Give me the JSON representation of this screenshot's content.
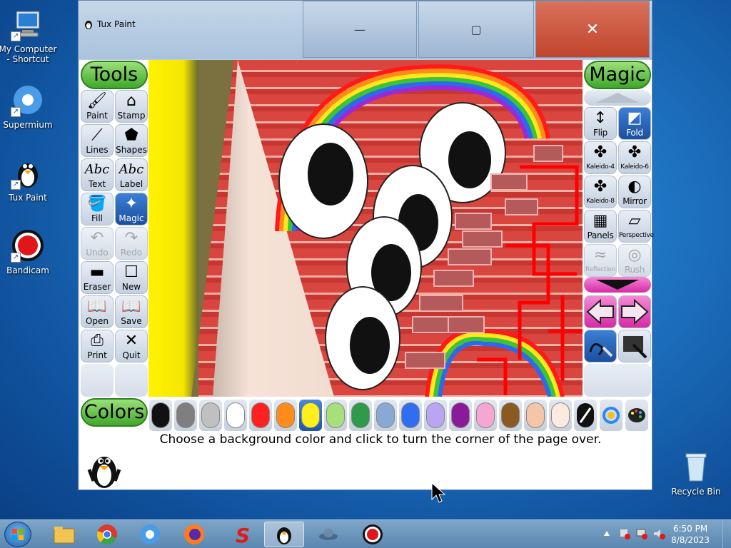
{
  "desktop": {
    "icons": [
      {
        "label": "My Computer - Shortcut"
      },
      {
        "label": "Supermium"
      },
      {
        "label": "Tux Paint"
      },
      {
        "label": "Bandicam"
      },
      {
        "label": "Recycle Bin"
      }
    ]
  },
  "window": {
    "title": "Tux Paint",
    "minimize_glyph": "—",
    "maximize_glyph": "▢",
    "close_glyph": "✕"
  },
  "tools": {
    "title": "Tools",
    "items": [
      {
        "label": "Paint",
        "icon": "paintbrush-icon",
        "glyph": "🖌"
      },
      {
        "label": "Stamp",
        "icon": "stamp-icon",
        "glyph": "⌂"
      },
      {
        "label": "Lines",
        "icon": "lines-icon",
        "glyph": "⟋"
      },
      {
        "label": "Shapes",
        "icon": "shapes-icon",
        "glyph": "⬟"
      },
      {
        "label": "Text",
        "icon": "text-icon",
        "glyph": "Abc"
      },
      {
        "label": "Label",
        "icon": "label-icon",
        "glyph": "Abc"
      },
      {
        "label": "Fill",
        "icon": "fill-icon",
        "glyph": "🪣"
      },
      {
        "label": "Magic",
        "icon": "magic-wand-icon",
        "glyph": "✦"
      },
      {
        "label": "Undo",
        "icon": "undo-icon",
        "glyph": "↶"
      },
      {
        "label": "Redo",
        "icon": "redo-icon",
        "glyph": "↷"
      },
      {
        "label": "Eraser",
        "icon": "eraser-icon",
        "glyph": "▬"
      },
      {
        "label": "New",
        "icon": "new-icon",
        "glyph": "☐"
      },
      {
        "label": "Open",
        "icon": "open-icon",
        "glyph": "📖"
      },
      {
        "label": "Save",
        "icon": "save-icon",
        "glyph": "📖"
      },
      {
        "label": "Print",
        "icon": "print-icon",
        "glyph": "⎙"
      },
      {
        "label": "Quit",
        "icon": "quit-icon",
        "glyph": "✕"
      }
    ]
  },
  "magic": {
    "title": "Magic",
    "items": [
      {
        "label": "Flip",
        "icon": "flip-icon",
        "glyph": "↕"
      },
      {
        "label": "Fold",
        "icon": "fold-icon",
        "glyph": "◩"
      },
      {
        "label": "Kaleido-4",
        "icon": "kaleido-4-icon",
        "glyph": "✤"
      },
      {
        "label": "Kaleido-6",
        "icon": "kaleido-6-icon",
        "glyph": "✤"
      },
      {
        "label": "Kaleido-8",
        "icon": "kaleido-8-icon",
        "glyph": "✤"
      },
      {
        "label": "Mirror",
        "icon": "mirror-icon",
        "glyph": "◐"
      },
      {
        "label": "Panels",
        "icon": "panels-icon",
        "glyph": "▦"
      },
      {
        "label": "Perspective",
        "icon": "perspective-icon",
        "glyph": "▱"
      },
      {
        "label": "Reflection",
        "icon": "reflection-icon",
        "glyph": "≈"
      },
      {
        "label": "Rush",
        "icon": "rush-icon",
        "glyph": "◎"
      }
    ]
  },
  "colors": {
    "title": "Colors",
    "swatches": [
      "#111111",
      "#7f7f7f",
      "#c0c0c0",
      "#ffffff",
      "#ff2020",
      "#ff8c1a",
      "#ffef1a",
      "#a6e07a",
      "#2e9a4a",
      "#8aa8d6",
      "#2f6ef0",
      "#b8a6f2",
      "#8a1a9a",
      "#f5a6d2",
      "#8a5a20",
      "#f2c6a6",
      "#faeae0"
    ],
    "selected_index": 6
  },
  "status": {
    "message": "Choose a background color and click to turn the corner of the page over."
  },
  "taskbar": {
    "time": "6:50 PM",
    "date": "8/8/2023"
  }
}
